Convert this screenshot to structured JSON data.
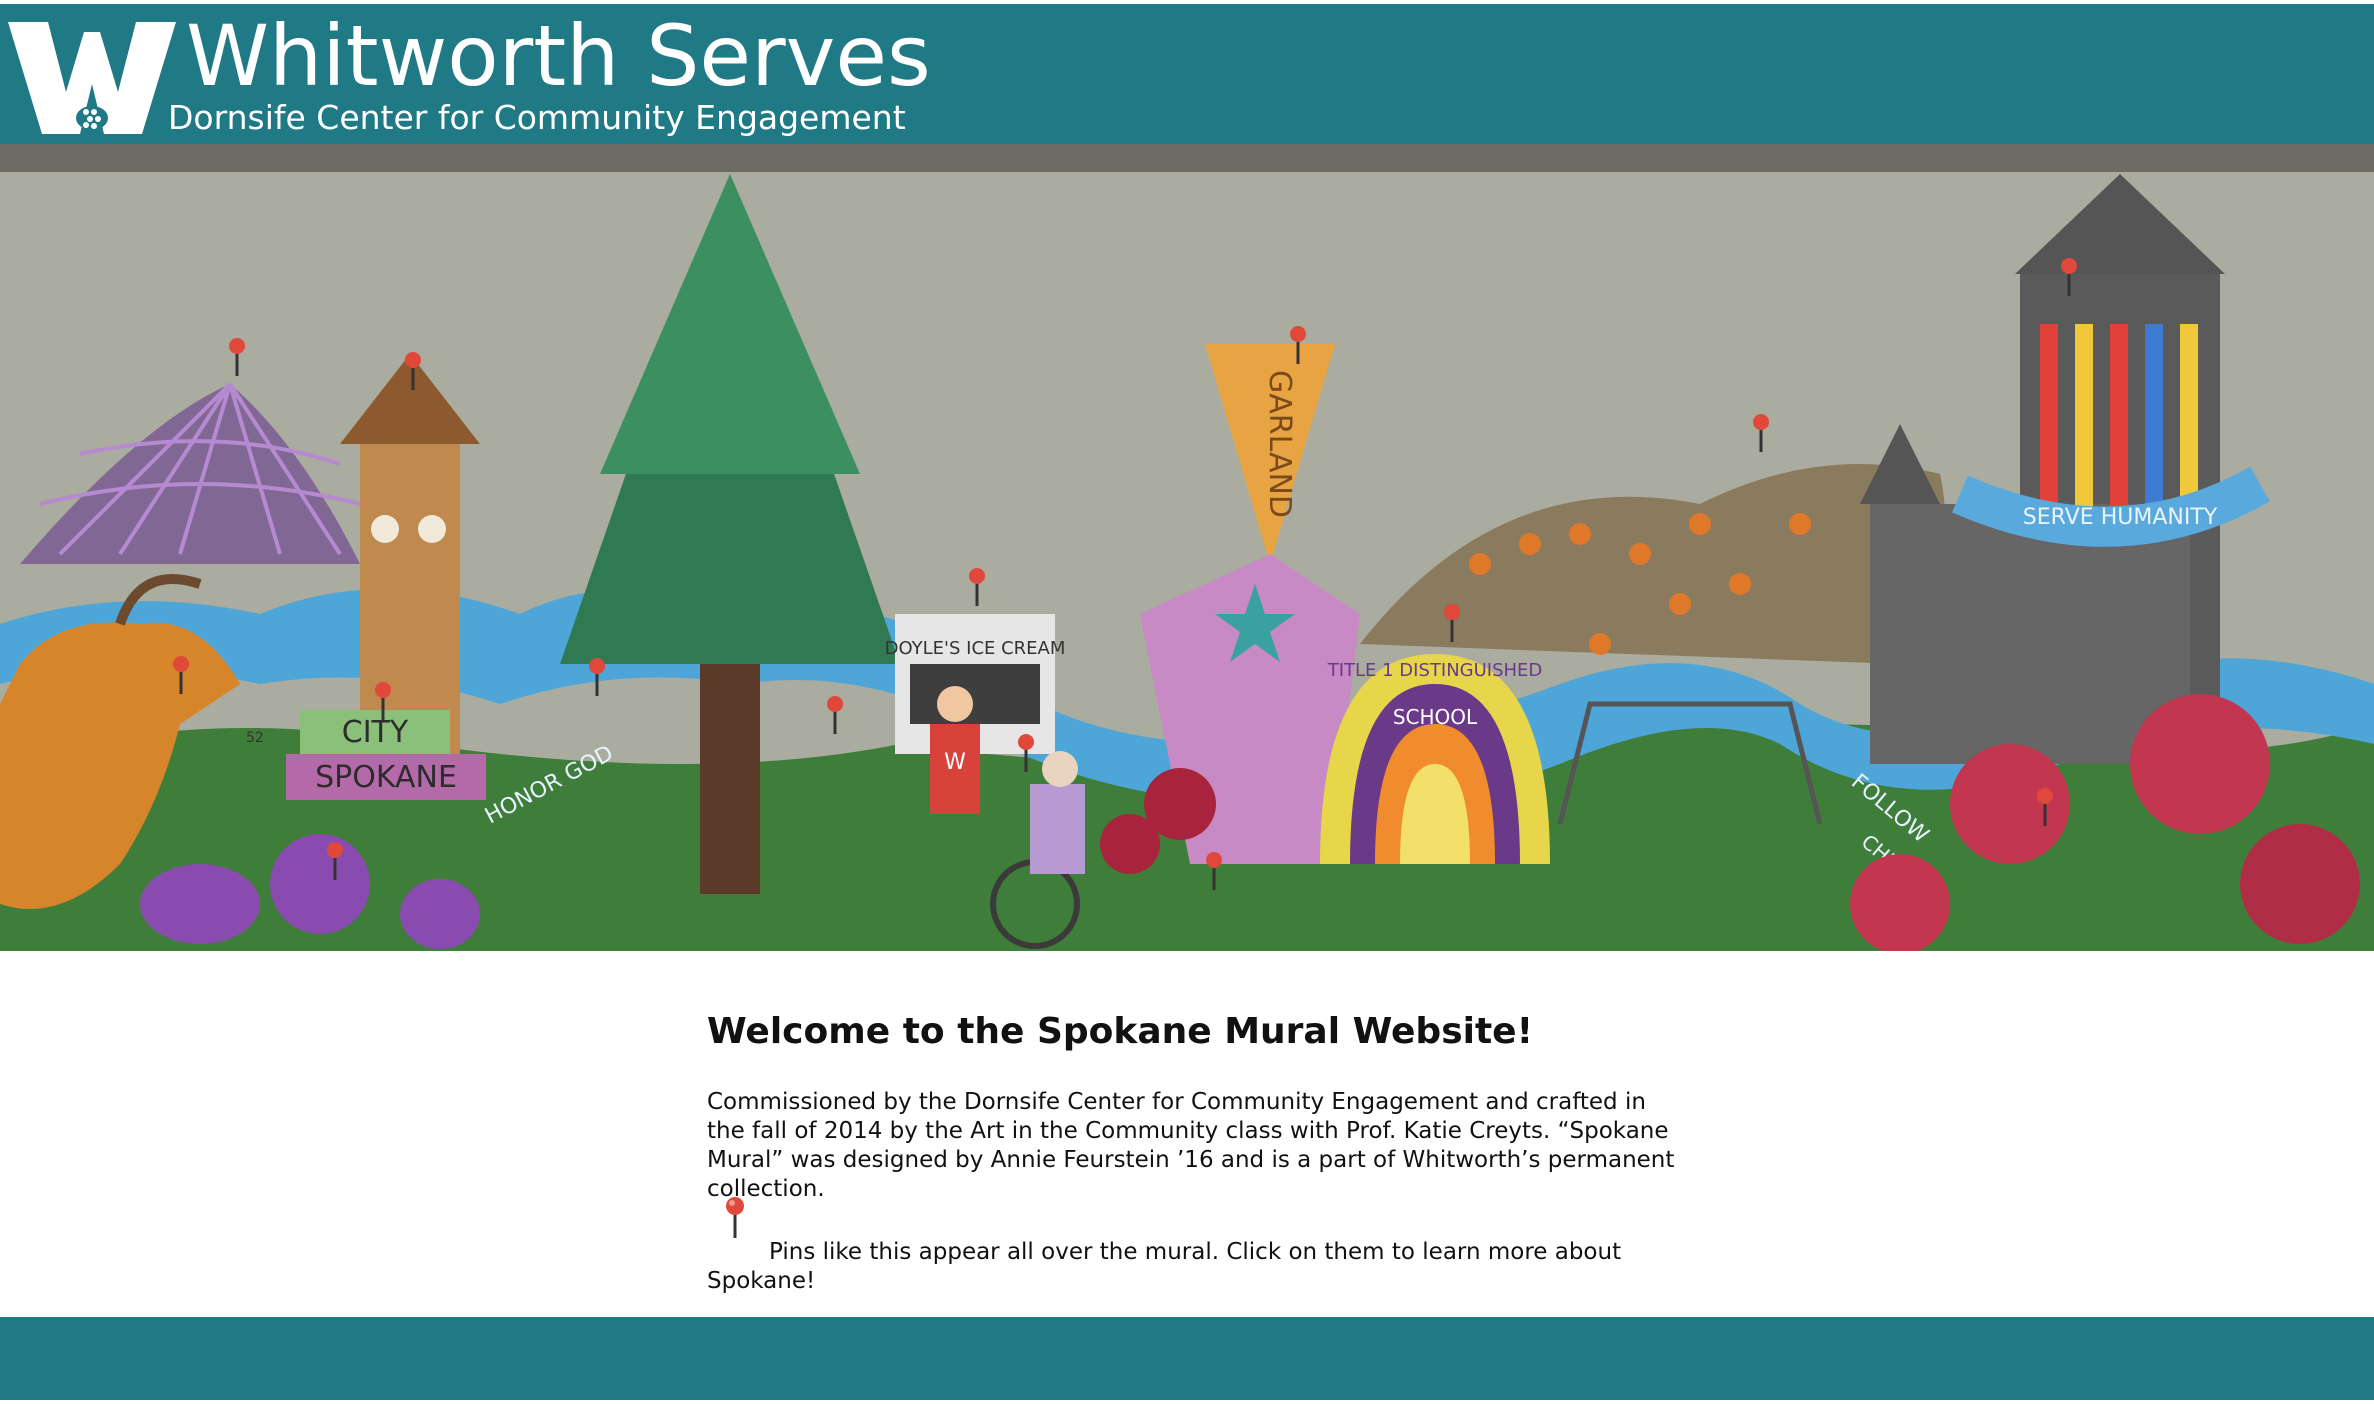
{
  "header": {
    "title": "Whitworth Serves",
    "subtitle": "Dornsife Center for Community Engagement",
    "logo_letter": "W",
    "color": "#1f7a86"
  },
  "mural": {
    "scene_labels": {
      "city": "CITY",
      "spokane": "SPOKANE",
      "honor_god": "HONOR GOD",
      "ice_cream": "DOYLE'S ICE CREAM",
      "garland": "GARLAND",
      "school": "SCHOOL",
      "title1": "TITLE 1 DISTINGUISHED",
      "follow": "FOLLOW",
      "christ": "CHRIST",
      "serve_humanity": "SERVE HUMANITY",
      "shirt_letter": "W",
      "runner_number": "52"
    },
    "pin_icon": "map-pin-icon",
    "pin_color": "#e0493a"
  },
  "content": {
    "heading": "Welcome to the Spokane Mural Website!",
    "paragraph": "Commissioned by the Dornsife Center for Community Engagement and crafted in the fall of 2014 by the Art in the Community class with Prof. Katie Creyts. “Spokane Mural” was designed by Annie Feurstein ’16 and is a part of Whitworth’s permanent collection.",
    "pin_note": "Pins like this appear all over the mural. Click on them to learn more about Spokane!"
  },
  "footer": {
    "color": "#1f7a86"
  }
}
